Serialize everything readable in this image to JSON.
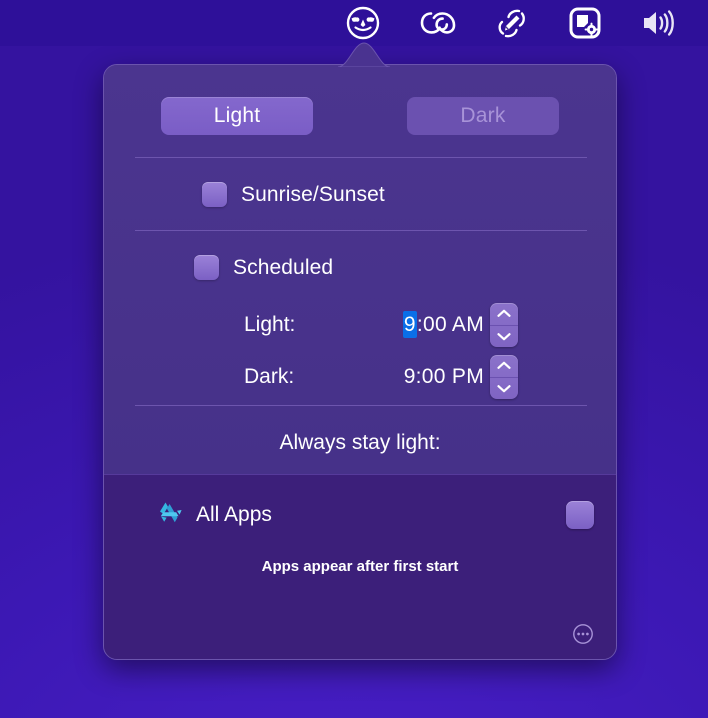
{
  "menubar": {
    "items": [
      {
        "name": "owl-icon",
        "label": "Night Owl"
      },
      {
        "name": "adobe-cc-icon",
        "label": "Adobe Creative Cloud"
      },
      {
        "name": "brush-clean-icon",
        "label": "CleanMyMac"
      },
      {
        "name": "screenshot-icon",
        "label": "Screenshot Tool"
      },
      {
        "name": "volume-icon",
        "label": "Volume"
      }
    ]
  },
  "popover": {
    "mode_segments": [
      {
        "label": "Light",
        "selected": true
      },
      {
        "label": "Dark",
        "selected": false
      }
    ],
    "sunrise": {
      "label": "Sunrise/Sunset",
      "checked": false
    },
    "scheduled": {
      "label": "Scheduled",
      "checked": false,
      "rows": [
        {
          "label": "Light:",
          "time_selected": "9",
          "time_rest": ":00 AM"
        },
        {
          "label": "Dark:",
          "time_selected": "",
          "time_rest": "9:00 PM"
        }
      ]
    },
    "always_stay_light_label": "Always stay light:",
    "apps": {
      "name": "All Apps",
      "checked": false,
      "hint": "Apps appear after first start"
    },
    "more_button_label": "•••"
  },
  "colors": {
    "desktop": "#3c18b4",
    "menubar": "#2e1099",
    "popover_top": "#463189",
    "popover_bottom": "#3c1f7a",
    "accent_selection": "#0a6fe8",
    "segment_active": "#7a5dc6",
    "checkbox": "#8a6fd0",
    "appstore_icon": "#35b7e0"
  }
}
